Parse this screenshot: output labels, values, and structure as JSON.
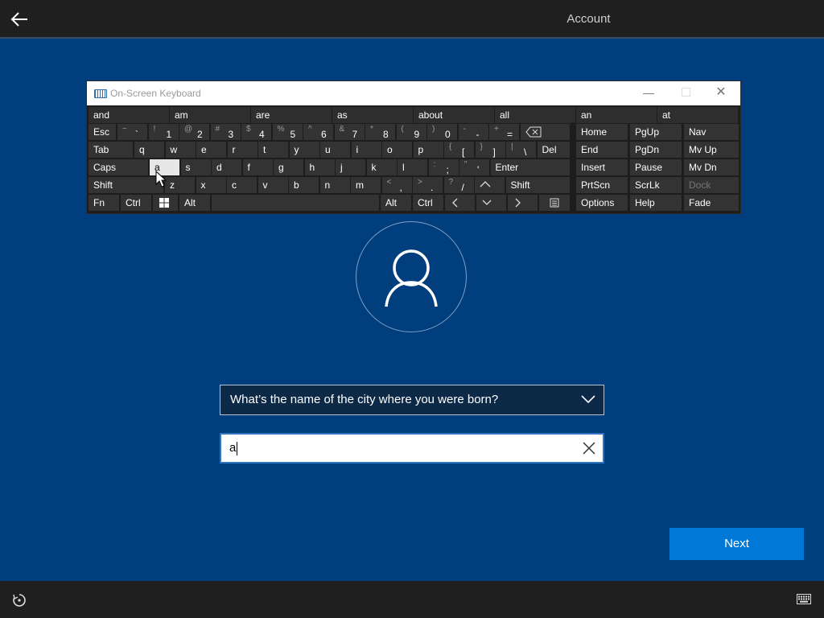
{
  "header": {
    "tab_label": "Account"
  },
  "keyboard": {
    "title": "On-Screen Keyboard",
    "predictions": [
      "and",
      "am",
      "are",
      "as",
      "about",
      "all",
      "an",
      "at"
    ],
    "row1": {
      "esc": "Esc",
      "keys": [
        {
          "s": "~",
          "b": "`"
        },
        {
          "s": "!",
          "b": "1"
        },
        {
          "s": "@",
          "b": "2"
        },
        {
          "s": "#",
          "b": "3"
        },
        {
          "s": "$",
          "b": "4"
        },
        {
          "s": "%",
          "b": "5"
        },
        {
          "s": "^",
          "b": "6"
        },
        {
          "s": "&",
          "b": "7"
        },
        {
          "s": "*",
          "b": "8"
        },
        {
          "s": "(",
          "b": "9"
        },
        {
          "s": ")",
          "b": "0"
        },
        {
          "s": "-",
          "b": "-"
        },
        {
          "s": "+",
          "b": "="
        }
      ]
    },
    "row2": {
      "tab": "Tab",
      "letters": [
        "q",
        "w",
        "e",
        "r",
        "t",
        "y",
        "u",
        "i",
        "o",
        "p"
      ],
      "brackets": [
        {
          "s": "{",
          "b": "["
        },
        {
          "s": "}",
          "b": "]"
        },
        {
          "s": "|",
          "b": "\\"
        }
      ],
      "del": "Del"
    },
    "row3": {
      "caps": "Caps",
      "letters": [
        "a",
        "s",
        "d",
        "f",
        "g",
        "h",
        "j",
        "k",
        "l"
      ],
      "punct": [
        {
          "s": ":",
          "b": ";"
        },
        {
          "s": "\"",
          "b": "'"
        }
      ],
      "enter": "Enter"
    },
    "row4": {
      "shift": "Shift",
      "letters": [
        "z",
        "x",
        "c",
        "v",
        "b",
        "n",
        "m"
      ],
      "punct": [
        {
          "s": "<",
          "b": ","
        },
        {
          "s": ">",
          "b": "."
        },
        {
          "s": "?",
          "b": "/"
        }
      ],
      "up": "^",
      "shift_right": "Shift"
    },
    "row5": {
      "fn": "Fn",
      "ctrl": "Ctrl",
      "alt": "Alt",
      "alt_right": "Alt",
      "ctrl_right": "Ctrl"
    },
    "nav_cols": [
      [
        "Home",
        "End",
        "Insert",
        "PrtScn",
        "Options"
      ],
      [
        "PgUp",
        "PgDn",
        "Pause",
        "ScrLk",
        "Help"
      ],
      [
        "Nav",
        "Mv Up",
        "Mv Dn",
        "Dock",
        "Fade"
      ]
    ]
  },
  "form": {
    "question": "What’s the name of the city where you were born?",
    "answer_value": "a"
  },
  "next_label": "Next"
}
